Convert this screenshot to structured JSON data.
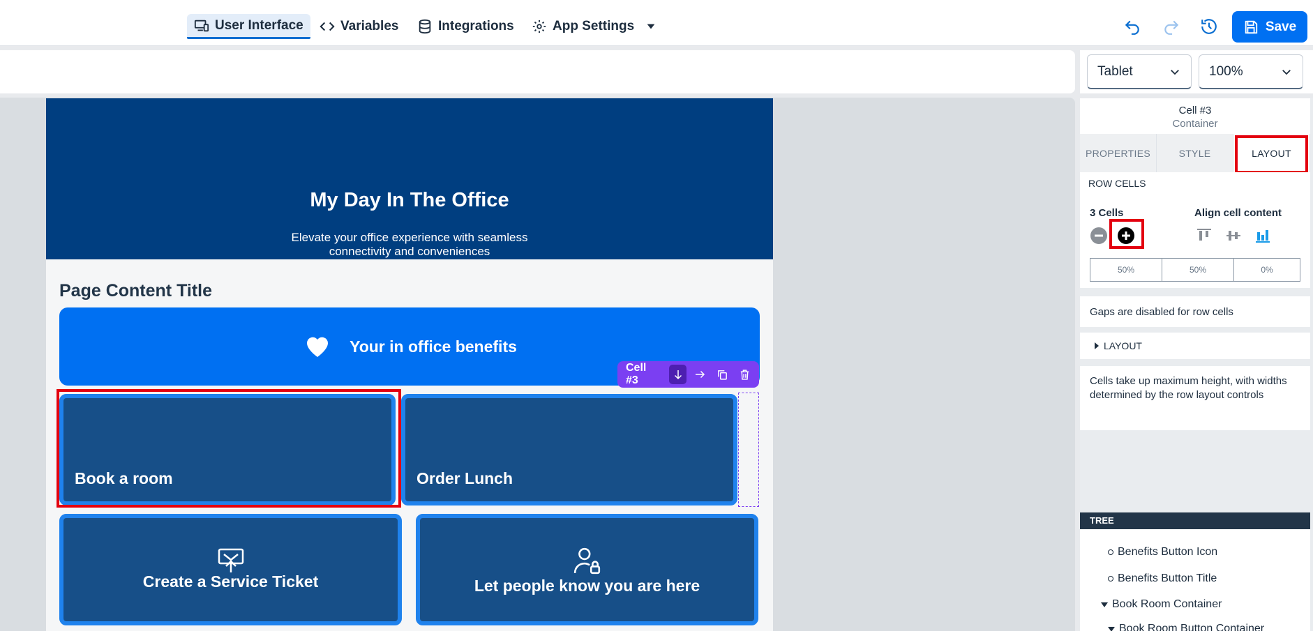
{
  "topbar": {
    "tabs": [
      {
        "label": "User Interface",
        "icon": "devices-icon"
      },
      {
        "label": "Variables",
        "icon": "code-icon"
      },
      {
        "label": "Integrations",
        "icon": "database-icon"
      },
      {
        "label": "App Settings",
        "icon": "gear-icon"
      }
    ],
    "save_label": "Save"
  },
  "device": {
    "selected": "Tablet"
  },
  "zoom": {
    "selected": "100%"
  },
  "page": {
    "hero_title": "My Day In The Office",
    "hero_subtitle": "Elevate your office experience with seamless connectivity and conveniences",
    "content_title": "Page Content Title",
    "benefits_label": "Your in office benefits",
    "tiles": {
      "book_room": "Book a room",
      "order_lunch": "Order Lunch",
      "service_ticket": "Create a Service Ticket",
      "presence": "Let people know you are here"
    }
  },
  "cell_toolbar": {
    "label": "Cell #3"
  },
  "panel": {
    "header_title": "Cell #3",
    "header_subtitle": "Container",
    "tabs": [
      "PROPERTIES",
      "STYLE",
      "LAYOUT"
    ],
    "row_cells_heading": "ROW CELLS",
    "cells_count": "3 Cells",
    "align_label": "Align cell content",
    "cell_widths": [
      "50%",
      "50%",
      "0%"
    ],
    "gaps_note": "Gaps are disabled for row cells",
    "layout_section": "LAYOUT",
    "layout_note": "Cells take up maximum height, with widths determined by the row layout controls",
    "tree_heading": "TREE",
    "tree_items": [
      "Benefits Button Icon",
      "Benefits Button Title",
      "Book Room Container",
      "Book Room Button Container"
    ]
  },
  "colors": {
    "accent": "#0070f2",
    "hero": "#003e80",
    "tile": "#174f88",
    "highlight": "#e3000f",
    "toolbar": "#7b3ff2"
  }
}
